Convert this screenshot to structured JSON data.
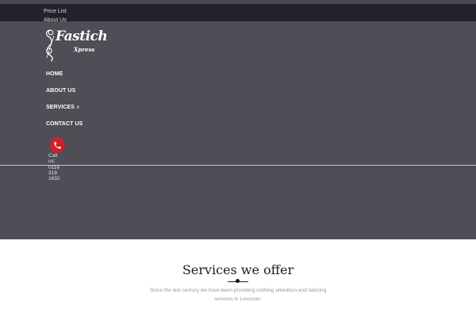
{
  "topbar": {
    "links": [
      "Price List",
      "About Us"
    ]
  },
  "brand": {
    "name": "Fastich",
    "sub": "Xpress"
  },
  "nav": {
    "items": [
      {
        "label": "HOME"
      },
      {
        "label": "ABOUT US"
      },
      {
        "label": "SERVICES"
      },
      {
        "label": "CONTACT US"
      }
    ],
    "dropdown_icon": "chevron-down-icon"
  },
  "call": {
    "icon": "phone-icon",
    "text": "Call us: 0116 319 1632",
    "button_color": "#c8232a"
  },
  "services": {
    "title": "Services we offer",
    "description": "Since the last century we have been providing clothing alteration and tailoring services in Leicester."
  },
  "colors": {
    "hero_bg": "#4d4e56",
    "topbar_bg": "#22222b",
    "accent": "#c8232a"
  }
}
